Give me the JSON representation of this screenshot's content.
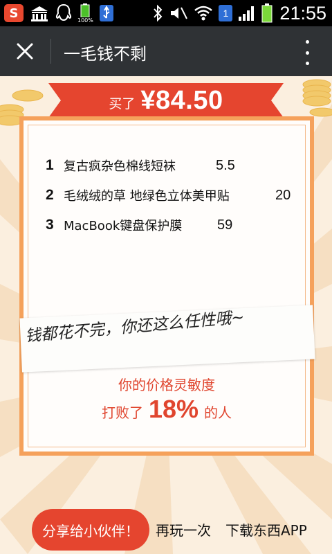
{
  "status_bar": {
    "time": "21:55",
    "battery_small_label": "100%",
    "sim_label": "1",
    "app_badge": "S",
    "icons": [
      "sogou-input-icon",
      "building-icon",
      "qq-icon",
      "battery-icon",
      "usb-icon",
      "bluetooth-icon",
      "mute-icon",
      "wifi-icon",
      "sim-icon",
      "signal-icon",
      "battery-full-icon"
    ]
  },
  "titlebar": {
    "title": "一毛钱不剩",
    "close_icon": "close-icon",
    "menu_icon": "more-vertical-icon"
  },
  "summary": {
    "prefix": "买了",
    "amount": "¥84.50"
  },
  "items": [
    {
      "num": "1",
      "name": "复古疯杂色棉线短袜",
      "price": "5.5"
    },
    {
      "num": "2",
      "name": "毛绒绒的草 地绿色立体美甲贴",
      "price": "20"
    },
    {
      "num": "3",
      "name": "MacBook键盘保护膜",
      "price": "59"
    }
  ],
  "slogan": "钱都花不完，你还这么任性哦~",
  "result": {
    "line1": "你的价格灵敏度",
    "prefix": "打败了",
    "percent": "18%",
    "suffix": "的人"
  },
  "actions": {
    "share": "分享给小伙伴！",
    "replay": "再玩一次",
    "download": "下载东西APP"
  },
  "colors": {
    "status_bar": "#000000",
    "title_bar": "#2f3235",
    "banner": "#e5452f",
    "card_border": "#f5a15b",
    "accent_red": "#e0452e",
    "background": "#fbefdf"
  }
}
